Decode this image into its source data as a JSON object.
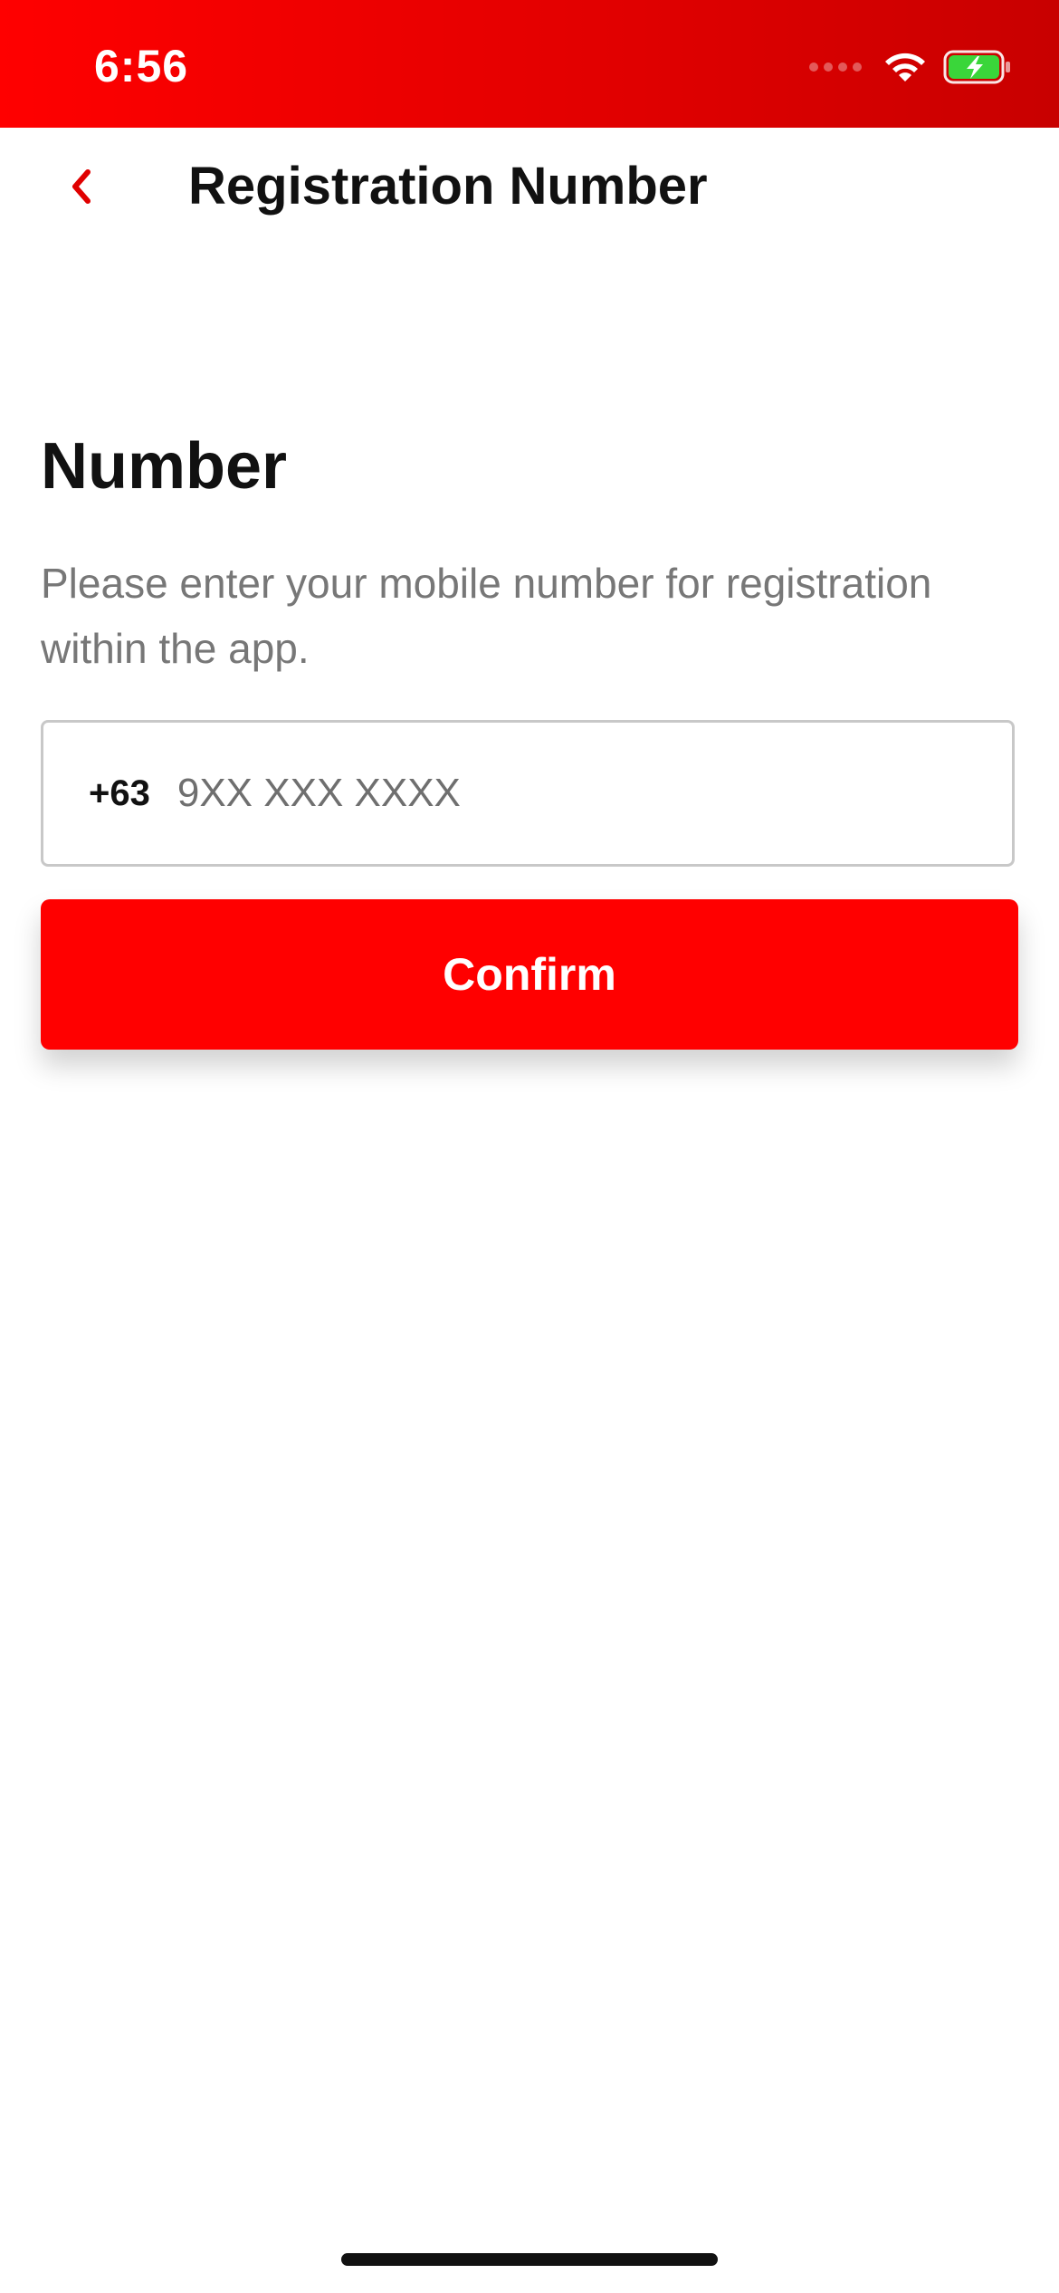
{
  "status_bar": {
    "time": "6:56",
    "icons": [
      "signal-dots-icon",
      "wifi-icon",
      "battery-charging-icon"
    ],
    "background_color": "#e00000"
  },
  "nav": {
    "back_icon": "chevron-left-icon",
    "title": "Registration Number"
  },
  "main": {
    "heading": "Number",
    "description": "Please enter your mobile number for registration within the app."
  },
  "phone_field": {
    "country_code": "+63",
    "placeholder": "9XX XXX XXXX",
    "value": ""
  },
  "confirm": {
    "label": "Confirm",
    "color": "#ff0000"
  },
  "colors": {
    "accent": "#ff0000",
    "text_primary": "#111111",
    "text_secondary": "#777777"
  }
}
